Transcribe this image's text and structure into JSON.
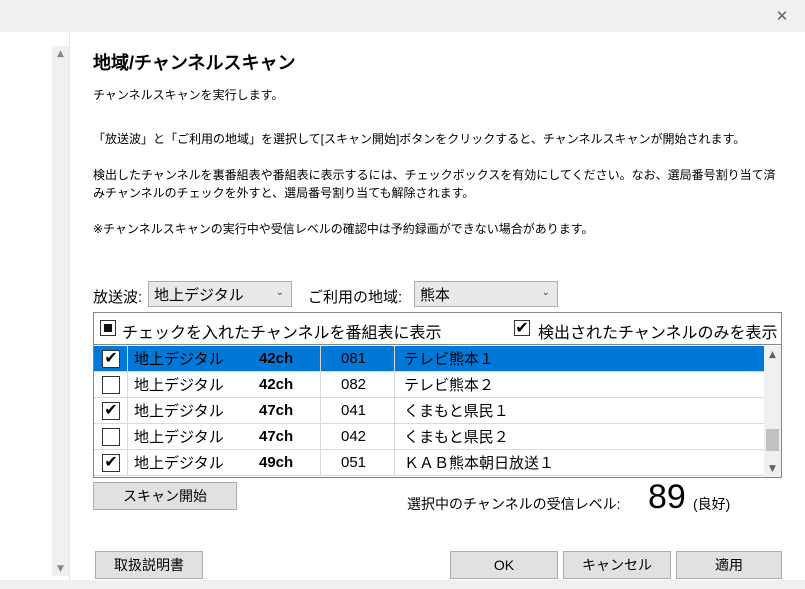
{
  "window": {
    "close_glyph": "✕"
  },
  "heading": "地域/チャンネルスキャン",
  "paragraphs": {
    "p1": "チャンネルスキャンを実行します。",
    "p2": "「放送波」と「ご利用の地域」を選択して[スキャン開始]ボタンをクリックすると、チャンネルスキャンが開始されます。",
    "p3": "検出したチャンネルを裏番組表や番組表に表示するには、チェックボックスを有効にしてください。なお、選局番号割り当て済みチャンネルのチェックを外すと、選局番号割り当ても解除されます。",
    "p4": "※チャンネルスキャンの実行中や受信レベルの確認中は予約録画ができない場合があります。"
  },
  "form": {
    "wave_label": "放送波:",
    "wave_value": "地上デジタル",
    "region_label": "ご利用の地域:",
    "region_value": "熊本"
  },
  "list": {
    "header_show_checked_label": "チェックを入れたチャンネルを番組表に表示",
    "header_show_checked_state": "indeterminate",
    "header_detected_only_label": "検出されたチャンネルのみを表示",
    "header_detected_only_checked": true,
    "rows": [
      {
        "checked": true,
        "wave": "地上デジタル",
        "ch": "42ch",
        "num": "081",
        "name": "テレビ熊本１",
        "selected": true
      },
      {
        "checked": false,
        "wave": "地上デジタル",
        "ch": "42ch",
        "num": "082",
        "name": "テレビ熊本２",
        "selected": false
      },
      {
        "checked": true,
        "wave": "地上デジタル",
        "ch": "47ch",
        "num": "041",
        "name": "くまもと県民１",
        "selected": false
      },
      {
        "checked": false,
        "wave": "地上デジタル",
        "ch": "47ch",
        "num": "042",
        "name": "くまもと県民２",
        "selected": false
      },
      {
        "checked": true,
        "wave": "地上デジタル",
        "ch": "49ch",
        "num": "051",
        "name": "ＫＡＢ熊本朝日放送１",
        "selected": false
      }
    ],
    "check_glyph": "✔"
  },
  "scan_button": "スキャン開始",
  "signal": {
    "label": "選択中のチャンネルの受信レベル:",
    "value": "89",
    "quality": "(良好)"
  },
  "footer": {
    "manual_button": "取扱説明書",
    "ok_button": "OK",
    "cancel_button": "キャンセル",
    "apply_button": "適用"
  },
  "colors": {
    "selection": "#0078d7",
    "button_bg": "#e1e1e1",
    "chrome_bg": "#f0f0f0"
  }
}
